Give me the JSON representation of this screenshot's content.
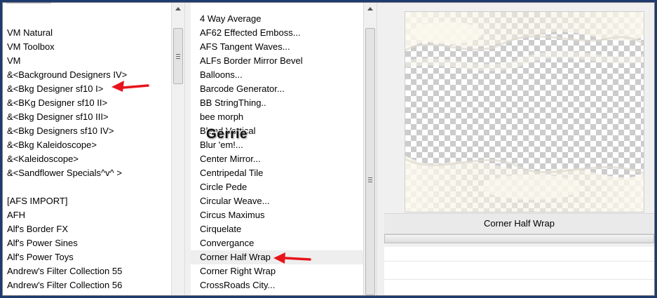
{
  "categories": [
    {
      "label": "VM Natural"
    },
    {
      "label": "VM Toolbox"
    },
    {
      "label": "VM"
    },
    {
      "label": "&<Background Designers IV>"
    },
    {
      "label": "&<Bkg Designer sf10 I>"
    },
    {
      "label": "&<BKg Designer sf10 II>"
    },
    {
      "label": "&<Bkg Designer sf10 III>"
    },
    {
      "label": "&<Bkg Designers sf10 IV>"
    },
    {
      "label": "&<Bkg Kaleidoscope>"
    },
    {
      "label": "&<Kaleidoscope>"
    },
    {
      "label": "&<Sandflower Specials^v^ >"
    },
    {
      "label": ""
    },
    {
      "label": "[AFS IMPORT]"
    },
    {
      "label": "AFH"
    },
    {
      "label": "Alf's Border FX"
    },
    {
      "label": "Alf's Power Sines"
    },
    {
      "label": "Alf's Power Toys"
    },
    {
      "label": "Andrew's Filter Collection 55"
    },
    {
      "label": "Andrew's Filter Collection 56"
    }
  ],
  "filters": [
    {
      "label": "4 Way Average"
    },
    {
      "label": "AF62 Effected Emboss..."
    },
    {
      "label": "AFS Tangent Waves..."
    },
    {
      "label": "ALFs Border Mirror Bevel"
    },
    {
      "label": "Balloons..."
    },
    {
      "label": "Barcode Generator..."
    },
    {
      "label": "BB StringThing.."
    },
    {
      "label": "bee morph"
    },
    {
      "label": "Blend Vertical"
    },
    {
      "label": "Blur 'em!..."
    },
    {
      "label": "Center Mirror..."
    },
    {
      "label": "Centripedal Tile"
    },
    {
      "label": "Circle Pede"
    },
    {
      "label": "Circular Weave..."
    },
    {
      "label": "Circus Maximus"
    },
    {
      "label": "Cirquelate"
    },
    {
      "label": "Convergance"
    },
    {
      "label": "Corner Half Wrap"
    },
    {
      "label": "Corner Right Wrap"
    },
    {
      "label": "CrossRoads City..."
    }
  ],
  "selected_filter_label": "Corner Half Wrap",
  "watermark": "Gerrie",
  "colors": {
    "arrow": "#e8141b",
    "selection": "#eeeeee",
    "page_bg": "#1e3a6e"
  },
  "icons": {
    "scroll_up": "arrow-up-icon",
    "annotation": "red-arrow-icon"
  }
}
